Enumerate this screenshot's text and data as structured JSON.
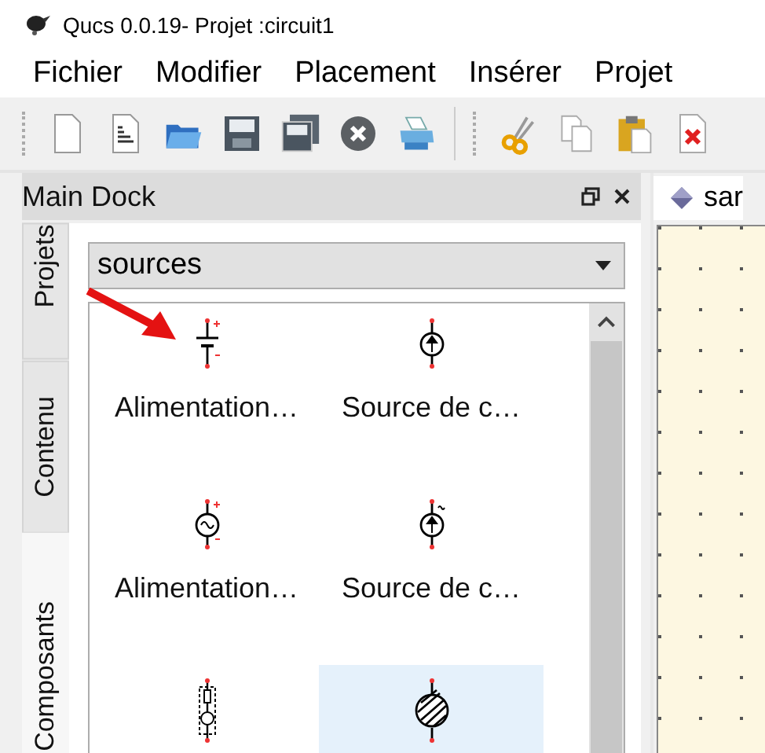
{
  "window": {
    "title": "Qucs 0.0.19- Projet :circuit1"
  },
  "menu": [
    "Fichier",
    "Modifier",
    "Placement",
    "Insérer",
    "Projet"
  ],
  "dock": {
    "title": "Main Dock",
    "tabs": [
      {
        "label": "Projets",
        "selected": false
      },
      {
        "label": "Contenu",
        "selected": false
      },
      {
        "label": "Composants",
        "selected": true
      }
    ],
    "category": "sources",
    "components": [
      {
        "kind": "dc-voltage",
        "label": "Alimentation…",
        "selected": false
      },
      {
        "kind": "dc-current",
        "label": "Source de c…",
        "selected": false
      },
      {
        "kind": "ac-voltage",
        "label": "Alimentation…",
        "selected": false
      },
      {
        "kind": "ac-current",
        "label": "Source de c…",
        "selected": false
      },
      {
        "kind": "resistor-source",
        "selected": false
      },
      {
        "kind": "hatched-source",
        "selected": true
      }
    ]
  },
  "editor": {
    "tab": "sar"
  }
}
